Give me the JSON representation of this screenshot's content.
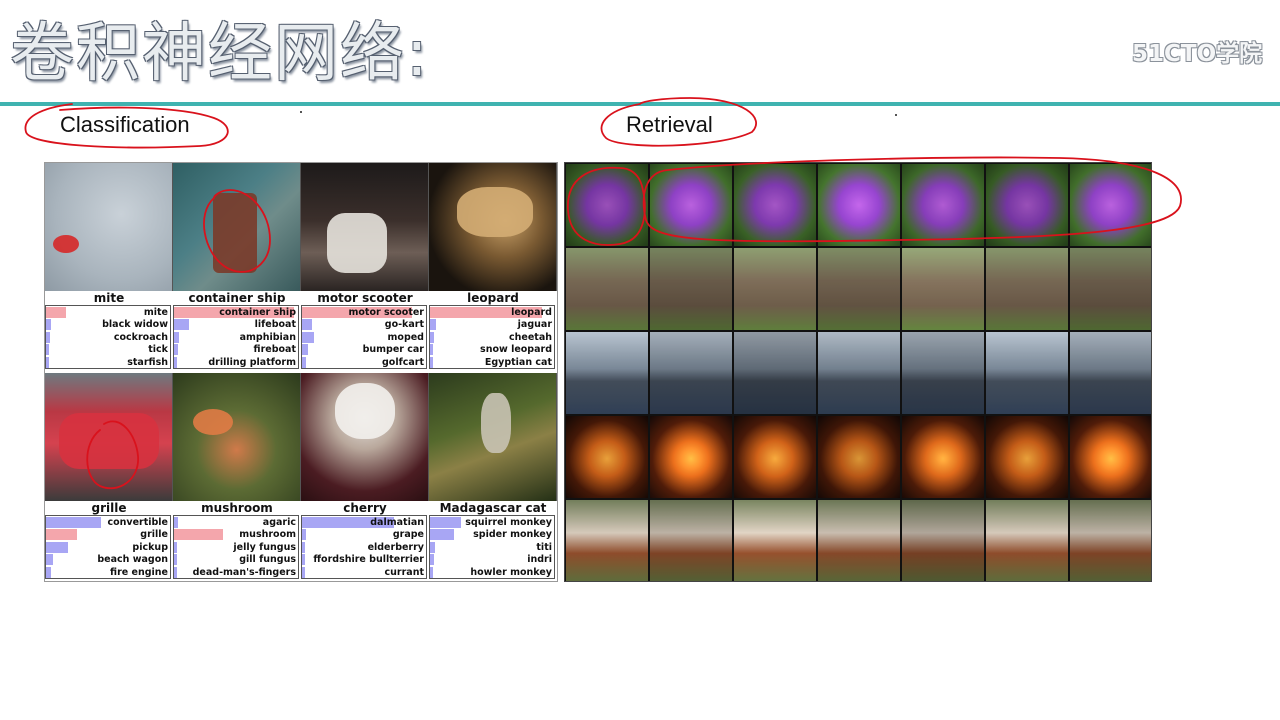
{
  "slide": {
    "title": "卷积神经网络:",
    "logo": "51CTO学院"
  },
  "sections": {
    "classification": "Classification",
    "retrieval": "Retrieval"
  },
  "classification": {
    "cells": [
      {
        "name": "mite",
        "preds": [
          {
            "label": "mite",
            "score": 0.16,
            "correct": true
          },
          {
            "label": "black widow",
            "score": 0.04,
            "correct": false
          },
          {
            "label": "cockroach",
            "score": 0.03,
            "correct": false
          },
          {
            "label": "tick",
            "score": 0.02,
            "correct": false
          },
          {
            "label": "starfish",
            "score": 0.02,
            "correct": false
          }
        ]
      },
      {
        "name": "container ship",
        "preds": [
          {
            "label": "container ship",
            "score": 0.98,
            "correct": true
          },
          {
            "label": "lifeboat",
            "score": 0.12,
            "correct": false
          },
          {
            "label": "amphibian",
            "score": 0.04,
            "correct": false
          },
          {
            "label": "fireboat",
            "score": 0.03,
            "correct": false
          },
          {
            "label": "drilling platform",
            "score": 0.02,
            "correct": false
          }
        ]
      },
      {
        "name": "motor scooter",
        "preds": [
          {
            "label": "motor scooter",
            "score": 0.9,
            "correct": true
          },
          {
            "label": "go-kart",
            "score": 0.08,
            "correct": false
          },
          {
            "label": "moped",
            "score": 0.1,
            "correct": false
          },
          {
            "label": "bumper car",
            "score": 0.05,
            "correct": false
          },
          {
            "label": "golfcart",
            "score": 0.03,
            "correct": false
          }
        ]
      },
      {
        "name": "leopard",
        "preds": [
          {
            "label": "leopard",
            "score": 0.92,
            "correct": true
          },
          {
            "label": "jaguar",
            "score": 0.05,
            "correct": false
          },
          {
            "label": "cheetah",
            "score": 0.03,
            "correct": false
          },
          {
            "label": "snow leopard",
            "score": 0.02,
            "correct": false
          },
          {
            "label": "Egyptian cat",
            "score": 0.01,
            "correct": false
          }
        ]
      },
      {
        "name": "grille",
        "preds": [
          {
            "label": "convertible",
            "score": 0.45,
            "correct": false
          },
          {
            "label": "grille",
            "score": 0.25,
            "correct": true
          },
          {
            "label": "pickup",
            "score": 0.18,
            "correct": false
          },
          {
            "label": "beach wagon",
            "score": 0.06,
            "correct": false
          },
          {
            "label": "fire engine",
            "score": 0.04,
            "correct": false
          }
        ]
      },
      {
        "name": "mushroom",
        "preds": [
          {
            "label": "agaric",
            "score": 0.03,
            "correct": false
          },
          {
            "label": "mushroom",
            "score": 0.4,
            "correct": true
          },
          {
            "label": "jelly fungus",
            "score": 0.02,
            "correct": false
          },
          {
            "label": "gill fungus",
            "score": 0.02,
            "correct": false
          },
          {
            "label": "dead-man's-fingers",
            "score": 0.02,
            "correct": false
          }
        ]
      },
      {
        "name": "cherry",
        "preds": [
          {
            "label": "dalmatian",
            "score": 0.75,
            "correct": false
          },
          {
            "label": "grape",
            "score": 0.03,
            "correct": false
          },
          {
            "label": "elderberry",
            "score": 0.02,
            "correct": false
          },
          {
            "label": "ffordshire bullterrier",
            "score": 0.02,
            "correct": false
          },
          {
            "label": "currant",
            "score": 0.01,
            "correct": false
          }
        ]
      },
      {
        "name": "Madagascar cat",
        "preds": [
          {
            "label": "squirrel monkey",
            "score": 0.25,
            "correct": false
          },
          {
            "label": "spider monkey",
            "score": 0.2,
            "correct": false
          },
          {
            "label": "titi",
            "score": 0.04,
            "correct": false
          },
          {
            "label": "indri",
            "score": 0.03,
            "correct": false
          },
          {
            "label": "howler monkey",
            "score": 0.02,
            "correct": false
          }
        ]
      }
    ]
  },
  "retrieval": {
    "rows": [
      {
        "subject": "purple flower"
      },
      {
        "subject": "elephant"
      },
      {
        "subject": "aircraft carrier"
      },
      {
        "subject": "jack-o'-lantern"
      },
      {
        "subject": "dog"
      }
    ],
    "columns": 7
  },
  "colors": {
    "accent": "#3fb3b0",
    "correct_bar": "#f4a6ac",
    "other_bar": "#a8a6f4",
    "annotation": "#d9121c"
  }
}
